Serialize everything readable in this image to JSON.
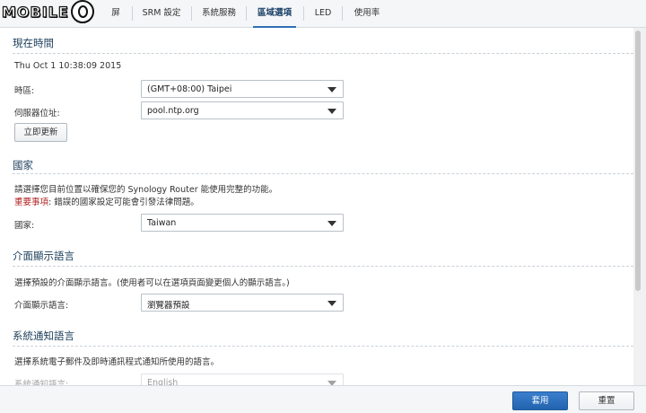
{
  "logo": {
    "text": "MOBILE"
  },
  "tabs": [
    {
      "label": "屏"
    },
    {
      "label": "SRM 設定"
    },
    {
      "label": "系統服務"
    },
    {
      "label": "區域選項"
    },
    {
      "label": "LED"
    },
    {
      "label": "使用率"
    }
  ],
  "time_section": {
    "title": "現在時間",
    "current_time": "Thu Oct 1 10:38:09 2015",
    "timezone_label": "時區:",
    "timezone_value": "(GMT+08:00) Taipei",
    "server_label": "伺服器位址:",
    "server_value": "pool.ntp.org",
    "update_button": "立即更新"
  },
  "country_section": {
    "title": "國家",
    "description": "請選擇您目前位置以確保您的 Synology Router 能使用完整的功能。",
    "warning_label": "重要事項",
    "warning_text": ": 錯誤的國家設定可能會引發法律問題。",
    "country_label": "國家:",
    "country_value": "Taiwan"
  },
  "ui_language_section": {
    "title": "介面顯示語言",
    "description": "選擇預設的介面顯示語言。(使用者可以在選項頁面變更個人的顯示語言。)",
    "language_label": "介面顯示語言:",
    "language_value": "瀏覽器預設"
  },
  "notify_language_section": {
    "title": "系統通知語言",
    "description": "選擇系統電子郵件及即時通訊程式通知所使用的語言。",
    "language_label": "系統通知語言:",
    "language_value": "English"
  },
  "footer": {
    "apply_button": "套用",
    "reset_button": "重置"
  }
}
